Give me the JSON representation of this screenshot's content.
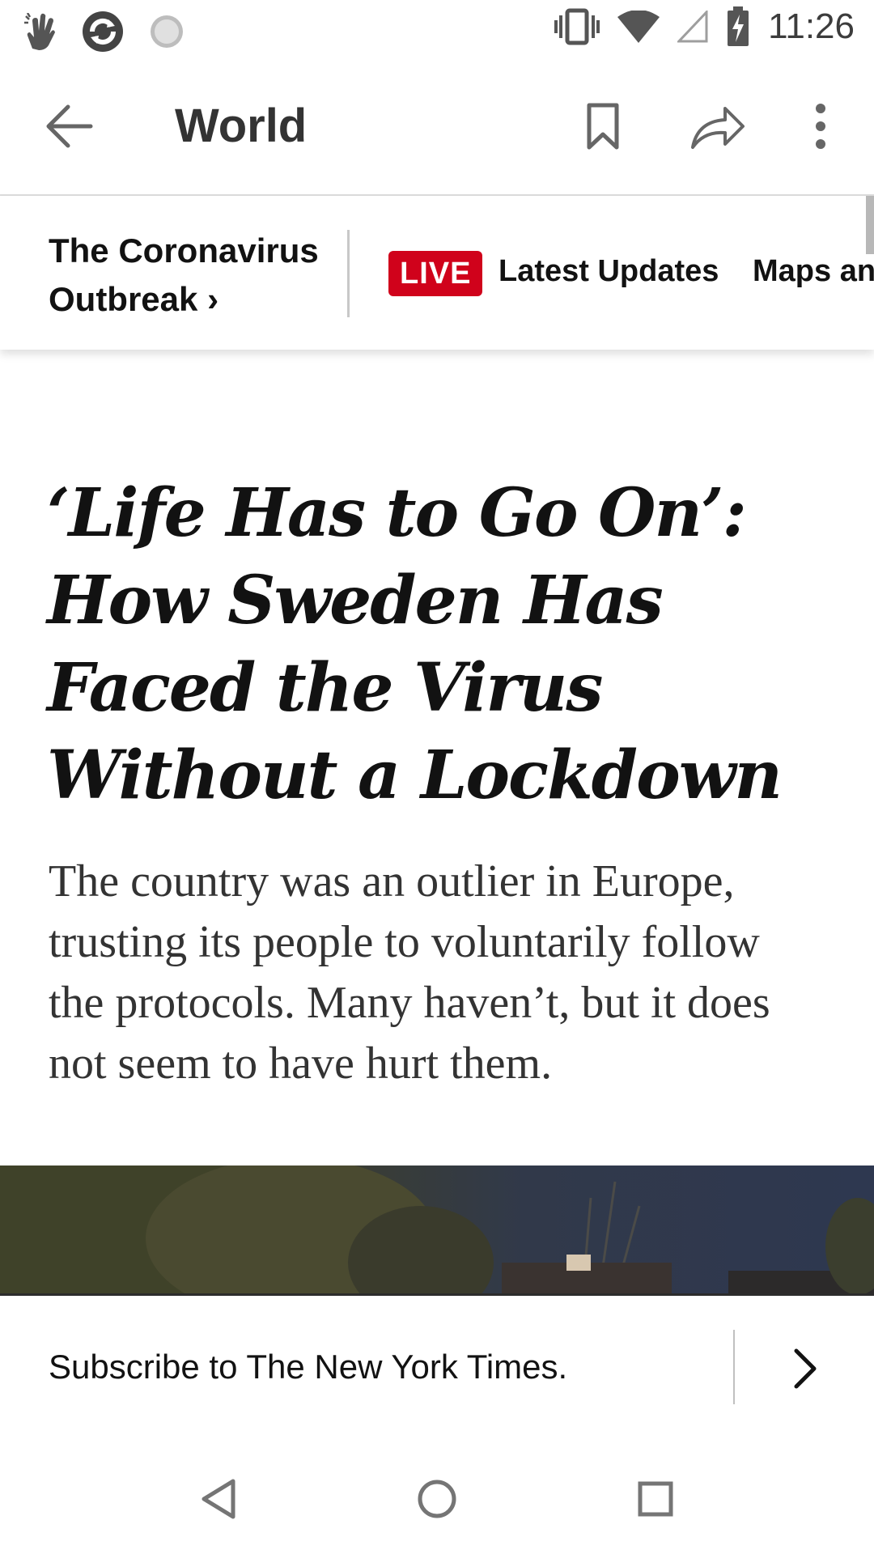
{
  "status_bar": {
    "time": "11:26",
    "icons": [
      "hand-icon",
      "sync-icon",
      "loading-icon",
      "vibrate-icon",
      "wifi-icon",
      "signal-icon",
      "battery-charging-icon"
    ]
  },
  "app_bar": {
    "title": "World",
    "icons": [
      "back-arrow-icon",
      "bookmark-icon",
      "share-icon",
      "more-vert-icon"
    ]
  },
  "story_bar": {
    "topic": "The Coronavirus Outbreak",
    "topic_chevron": "›",
    "live_badge": "LIVE",
    "links": [
      "Latest Updates",
      "Maps and"
    ]
  },
  "article": {
    "headline": "‘Life Has to Go On’: How Sweden Has Faced the Virus Without a Lockdown",
    "summary": "The country was an outlier in Europe, trusting its people to voluntarily follow the protocols. Many haven’t, but it does not seem to have hurt them."
  },
  "subscribe": {
    "text": "Subscribe to The New York Times."
  },
  "nav_bar": {
    "icons": [
      "back-triangle-icon",
      "home-circle-icon",
      "recents-square-icon"
    ]
  },
  "colors": {
    "live_red": "#d0021b",
    "text_dark": "#121212",
    "icon_gray": "#757575"
  }
}
